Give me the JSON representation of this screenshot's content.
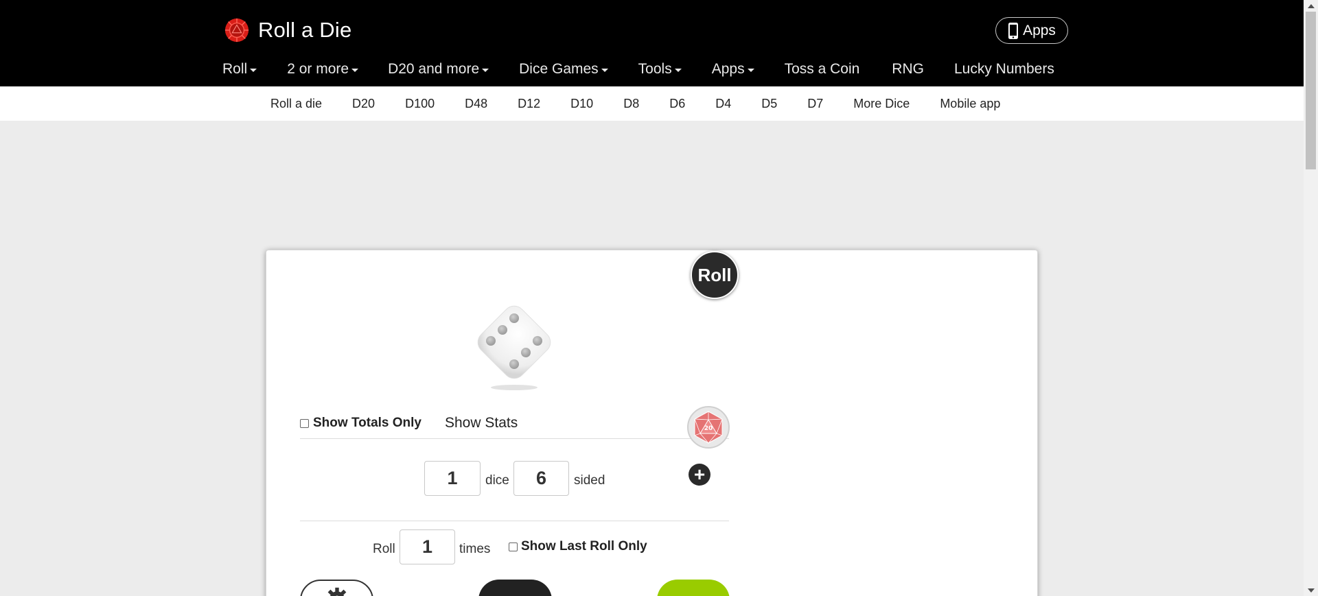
{
  "header": {
    "brand_name": "Roll a Die",
    "apps_button_label": "Apps",
    "nav": [
      {
        "label": "Roll",
        "dropdown": true
      },
      {
        "label": "2 or more",
        "dropdown": true
      },
      {
        "label": "D20 and more",
        "dropdown": true
      },
      {
        "label": "Dice Games",
        "dropdown": true
      },
      {
        "label": "Tools",
        "dropdown": true
      },
      {
        "label": "Apps",
        "dropdown": true
      },
      {
        "label": "Toss a Coin",
        "dropdown": false
      },
      {
        "label": "RNG",
        "dropdown": false
      },
      {
        "label": "Lucky Numbers",
        "dropdown": false
      }
    ]
  },
  "subnav": {
    "items": [
      "Roll a die",
      "D20",
      "D100",
      "D48",
      "D12",
      "D10",
      "D8",
      "D6",
      "D4",
      "D5",
      "D7",
      "More Dice",
      "Mobile app"
    ]
  },
  "roller": {
    "roll_button_label": "Roll",
    "die_face_value": 5,
    "show_totals_label": "Show Totals Only",
    "show_totals_checked": false,
    "show_stats_label": "Show Stats",
    "d20_icon_text": "20",
    "dice_count": "1",
    "dice_label": "dice",
    "sides": "6",
    "sided_label": "sided",
    "roll_label": "Roll",
    "times": "1",
    "times_label": "times",
    "show_last_roll_label": "Show Last Roll Only",
    "show_last_roll_checked": false
  },
  "colors": {
    "header_bg": "#000000",
    "brand_logo": "#d91e18",
    "page_bg": "#ececec",
    "roll_button": "#2a2a2a",
    "d20_icon": "#e57373",
    "green_button": "#99cc00"
  },
  "icons": {
    "brand": "red-die-logo-icon",
    "apps": "phone-icon",
    "d20": "d20-icon",
    "add": "plus-circle-icon",
    "settings": "gear-icon"
  }
}
